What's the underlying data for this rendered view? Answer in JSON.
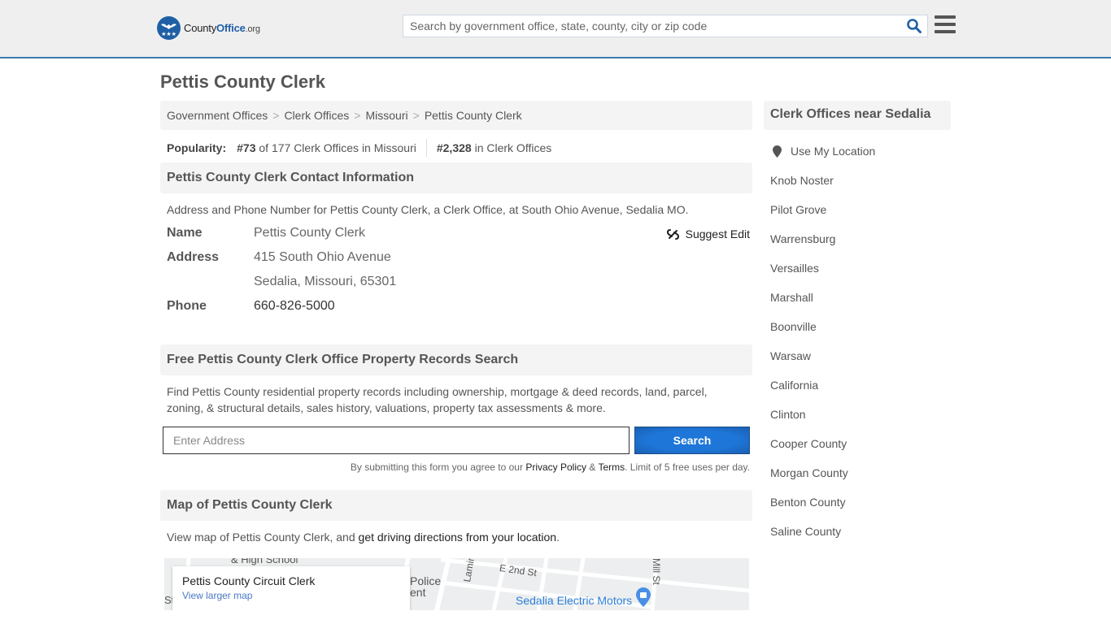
{
  "header": {
    "logo": {
      "name": "County",
      "name_bold": "Office",
      "tld": ".org"
    },
    "search_placeholder": "Search by government office, state, county, city or zip code",
    "search_icon": "search-icon",
    "menu_icon": "hamburger-menu-icon"
  },
  "page_title": "Pettis County Clerk",
  "breadcrumb": [
    {
      "label": "Government Offices"
    },
    {
      "label": "Clerk Offices"
    },
    {
      "label": "Missouri"
    },
    {
      "label": "Pettis County Clerk"
    }
  ],
  "breadcrumb_separator": ">",
  "popularity": {
    "label": "Popularity:",
    "state_rank": "#73",
    "state_text": "of 177 Clerk Offices in Missouri",
    "national_rank": "#2,328",
    "national_text": "in Clerk Offices"
  },
  "contact": {
    "heading": "Pettis County Clerk Contact Information",
    "description": "Address and Phone Number for Pettis County Clerk, a Clerk Office, at South Ohio Avenue, Sedalia MO.",
    "name_label": "Name",
    "name_value": "Pettis County Clerk",
    "address_label": "Address",
    "address_line1": "415 South Ohio Avenue",
    "address_line2": "Sedalia, Missouri, 65301",
    "phone_label": "Phone",
    "phone_value": "660-826-5000",
    "suggest_edit": "Suggest Edit"
  },
  "property": {
    "heading": "Free Pettis County Clerk Office Property Records Search",
    "description": "Find Pettis County residential property records including ownership, mortgage & deed records, land, parcel, zoning, & structural details, sales history, valuations, property tax assessments & more.",
    "input_placeholder": "Enter Address",
    "search_button": "Search",
    "disclaimer_pre": "By submitting this form you agree to our ",
    "privacy_link": "Privacy Policy",
    "amp": " & ",
    "terms_link": "Terms",
    "disclaimer_post": ". Limit of 5 free uses per day."
  },
  "map": {
    "heading": "Map of Pettis County Clerk",
    "description_pre": "View map of Pettis County Clerk, and ",
    "directions_link": "get driving directions from your location",
    "description_post": ".",
    "card_title": "Pettis County Circuit Clerk",
    "card_link": "View larger map",
    "labels": {
      "school": "& High School",
      "police1": "Police",
      "police2": "ent",
      "st_left": "St",
      "lamine": "Lamine Ave",
      "second": "E 2nd St",
      "mill": "Mill St",
      "poi": "Sedalia Electric Motors"
    }
  },
  "sidebar": {
    "heading": "Clerk Offices near Sedalia",
    "use_location": "Use My Location",
    "items": [
      {
        "label": "Knob Noster"
      },
      {
        "label": "Pilot Grove"
      },
      {
        "label": "Warrensburg"
      },
      {
        "label": "Versailles"
      },
      {
        "label": "Marshall"
      },
      {
        "label": "Boonville"
      },
      {
        "label": "Warsaw"
      },
      {
        "label": "California"
      },
      {
        "label": "Clinton"
      },
      {
        "label": "Cooper County"
      },
      {
        "label": "Morgan County"
      },
      {
        "label": "Benton County"
      },
      {
        "label": "Saline County"
      }
    ]
  },
  "colors": {
    "brand_blue": "#1f5fa6",
    "header_border": "#3a7cb0",
    "button_blue": "#1e76d8",
    "map_poi": "#2d7fd9"
  }
}
